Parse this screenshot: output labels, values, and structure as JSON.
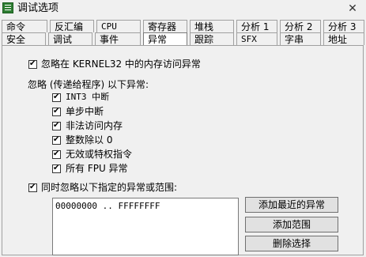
{
  "window": {
    "title": "调试选项",
    "close_glyph": "✕",
    "app_icon": "list-icon"
  },
  "tabs_row1": [
    {
      "label": "命令"
    },
    {
      "label": "反汇编"
    },
    {
      "label": "CPU"
    },
    {
      "label": "寄存器"
    },
    {
      "label": "堆栈"
    },
    {
      "label": "分析 1"
    },
    {
      "label": "分析 2"
    },
    {
      "label": "分析 3"
    }
  ],
  "tabs_row2": [
    {
      "label": "安全"
    },
    {
      "label": "调试"
    },
    {
      "label": "事件"
    },
    {
      "label": "异常"
    },
    {
      "label": "跟踪"
    },
    {
      "label": "SFX"
    },
    {
      "label": "字串"
    },
    {
      "label": "地址"
    }
  ],
  "active_tab": "异常",
  "options": {
    "ignore_kernel32": "忽略在 KERNEL32 中的内存访问异常",
    "group_label": "忽略 (传递给程序) 以下异常:",
    "int3": "INT3 中断",
    "single_step": "单步中断",
    "illegal_access": "非法访问内存",
    "div_zero": "整数除以 0",
    "invalid_instr": "无效或特权指令",
    "fpu": "所有 FPU 异常",
    "ignore_ranges": "同时忽略以下指定的异常或范围:"
  },
  "range_list": [
    "00000000 .. FFFFFFFF"
  ],
  "buttons": {
    "add_recent": "添加最近的异常",
    "add_range": "添加范围",
    "delete_selection": "删除选择"
  }
}
